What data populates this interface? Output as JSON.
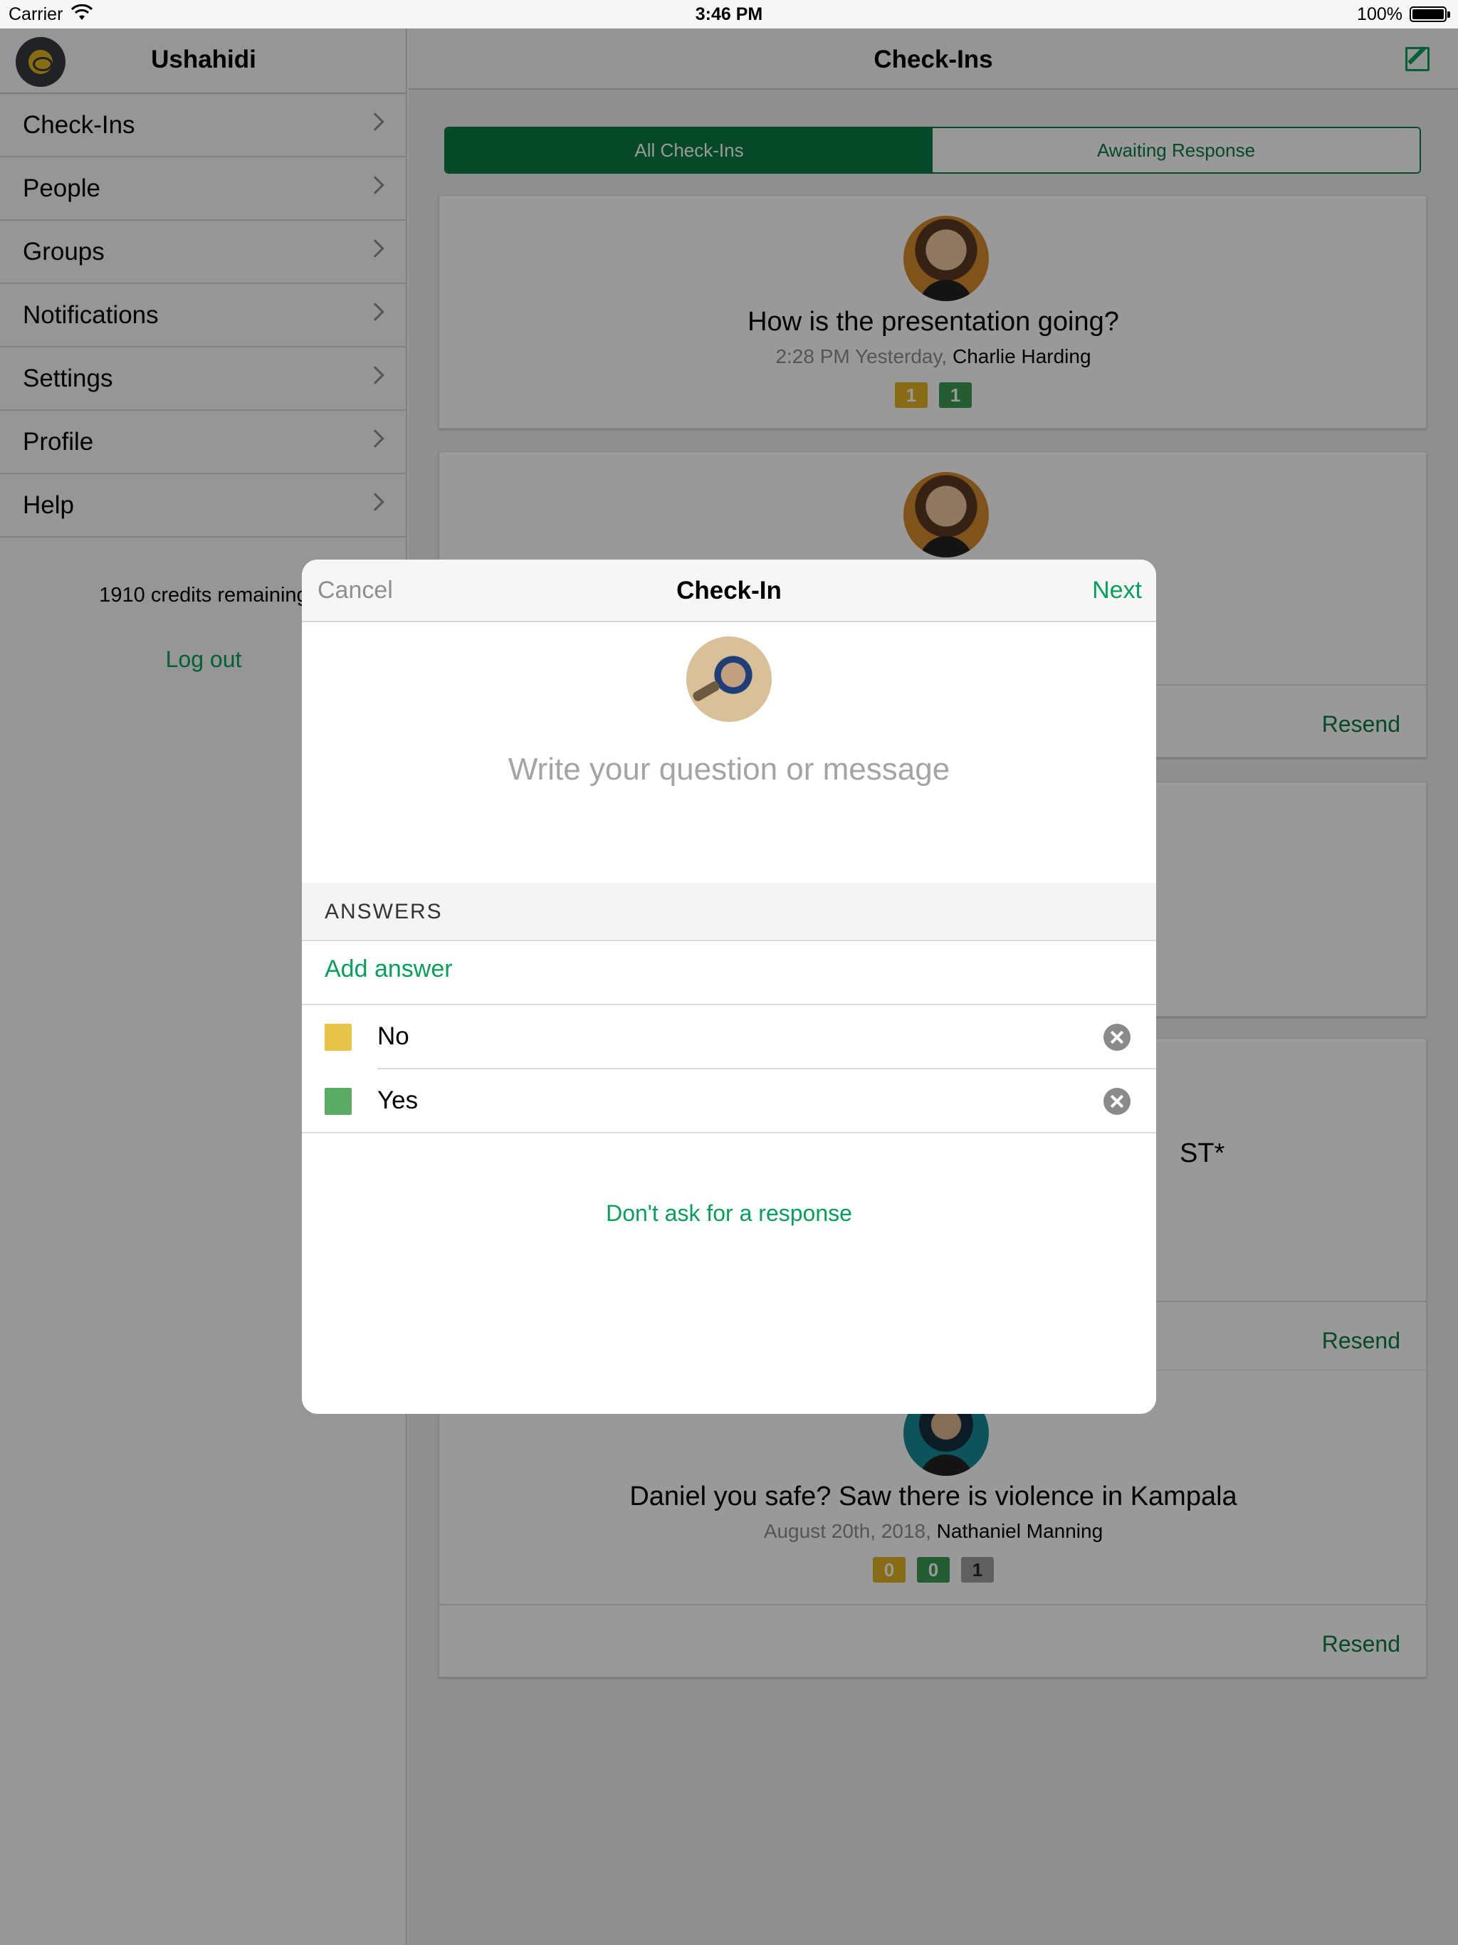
{
  "status_bar": {
    "carrier": "Carrier",
    "time": "3:46 PM",
    "battery": "100%"
  },
  "sidebar": {
    "title": "Ushahidi",
    "items": [
      {
        "label": "Check-Ins"
      },
      {
        "label": "People"
      },
      {
        "label": "Groups"
      },
      {
        "label": "Notifications"
      },
      {
        "label": "Settings"
      },
      {
        "label": "Profile"
      },
      {
        "label": "Help"
      }
    ],
    "credits": "1910 credits remaining",
    "logout": "Log out"
  },
  "main": {
    "title": "Check-Ins",
    "tabs": [
      {
        "label": "All Check-Ins",
        "active": true
      },
      {
        "label": "Awaiting Response",
        "active": false
      }
    ],
    "cards": [
      {
        "question": "How is the presentation going?",
        "time": "2:28 PM Yesterday,",
        "author": "Charlie Harding",
        "counts": [
          "1",
          "1"
        ]
      },
      {
        "resend": "Resend"
      },
      {
        "partial_text": "ST*",
        "resend": "Resend"
      },
      {
        "question": "Daniel you safe? Saw there is violence in Kampala",
        "time": "August 20th, 2018,",
        "author": "Nathaniel Manning",
        "counts": [
          "0",
          "0",
          "1"
        ],
        "resend": "Resend"
      }
    ]
  },
  "modal": {
    "cancel": "Cancel",
    "title": "Check-In",
    "next": "Next",
    "placeholder": "Write your question or message",
    "answers_header": "ANSWERS",
    "add_answer": "Add answer",
    "answers": [
      {
        "label": "No",
        "color": "#e8c34a"
      },
      {
        "label": "Yes",
        "color": "#5aab64"
      }
    ],
    "no_response": "Don't ask for a response"
  },
  "colors": {
    "accent": "#07a05a",
    "dark_green": "#0a7a45",
    "yellow": "#e3b424",
    "green": "#3d9a52"
  }
}
